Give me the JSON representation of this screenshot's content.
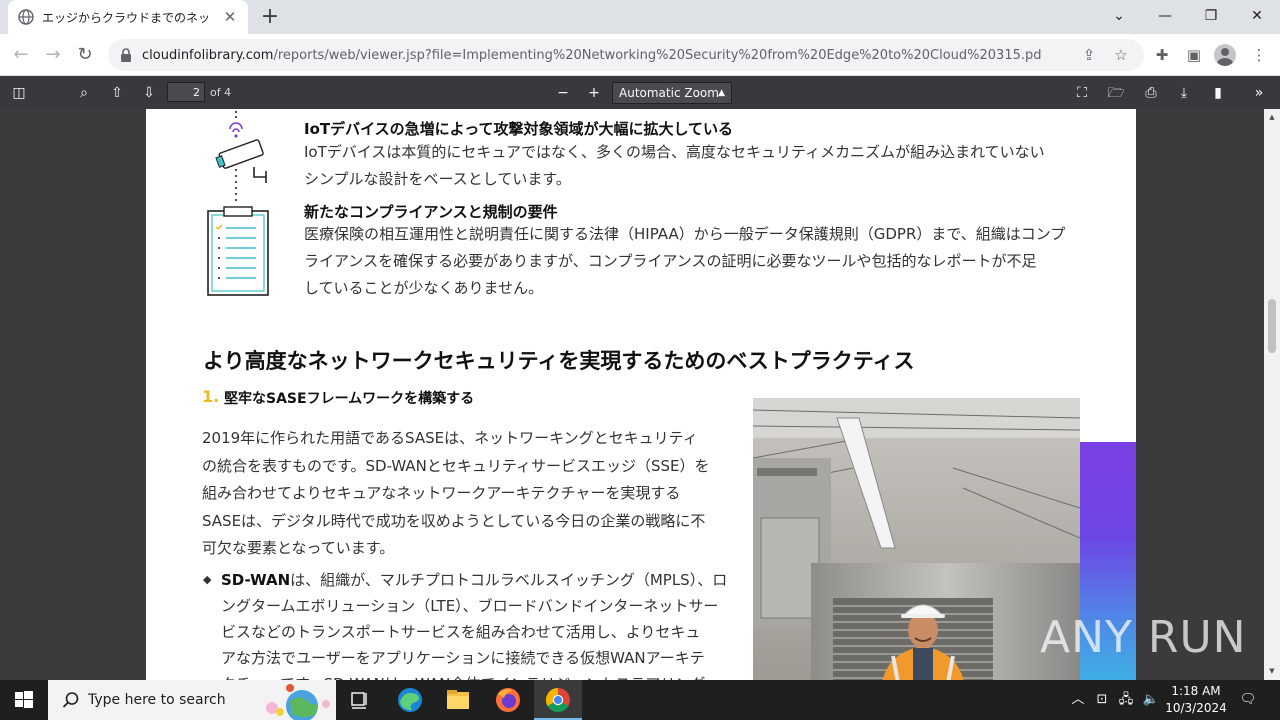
{
  "browser": {
    "tab_title": "エッジからクラウドまでのネットワーキング",
    "new_tab": "+",
    "url_host": "cloudinfolibrary.com",
    "url_path": "/reports/web/viewer.jsp?file=Implementing%20Networking%20Security%20from%20Edge%20to%20Cloud%20315.pdf",
    "window_controls": {
      "minimize": "—",
      "restore": "❐",
      "close": "✕",
      "tab_list": "⌄"
    }
  },
  "pdf_toolbar": {
    "page_number": "2",
    "page_count": "of 4",
    "zoom": "Automatic Zoom",
    "zoom_out": "−",
    "zoom_in": "+"
  },
  "document": {
    "item1": {
      "heading": "IoTデバイスの急増によって攻撃対象領域が大幅に拡大している",
      "lines": [
        "IoTデバイスは本質的にセキュアではなく、多くの場合、高度なセキュリティメカニズムが組み込まれていない",
        "シンプルな設計をベースとしています。"
      ]
    },
    "item2": {
      "heading": "新たなコンプライアンスと規制の要件",
      "lines": [
        "医療保険の相互運用性と説明責任に関する法律（HIPAA）から一般データ保護規則（GDPR）まで、組織はコンプ",
        "ライアンスを確保する必要がありますが、コンプライアンスの証明に必要なツールや包括的なレポートが不足",
        "していることが少なくありません。"
      ]
    },
    "section_title": "より高度なネットワークセキュリティを実現するためのベストプラクティス",
    "step_number": "1.",
    "step_title": "堅牢なSASEフレームワークを構築する",
    "paragraph_lines": [
      "2019年に作られた用語であるSASEは、ネットワーキングとセキュリティ",
      "の統合を表すものです。SD-WANとセキュリティサービスエッジ（SSE）を",
      "組み合わせてよりセキュアなネットワークアーキテクチャーを実現する",
      "SASEは、デジタル時代で成功を収めようとしている今日の企業の戦略に不",
      "可欠な要素となっています。"
    ],
    "bullet": {
      "bold": "SD-WAN",
      "lines": [
        "は、組織が、マルチプロトコルラベルスイッチング（MPLS）、ロ",
        "ングタームエボリューション（LTE）、ブロードバンドインターネットサー",
        "ビスなどのトランスポートサービスを組み合わせて活用し、よりセキュ",
        "アな方法でユーザーをアプリケーションに接続できる仮想WANアーキテ",
        "クチャーです。SD-WANは、WAN全体でインテリジェントステアリング"
      ]
    },
    "accent_color": "#f5b81b"
  },
  "watermark": "ANY RUN",
  "taskbar": {
    "search_placeholder": "Type here to search",
    "time": "1:18 AM",
    "date": "10/3/2024"
  }
}
